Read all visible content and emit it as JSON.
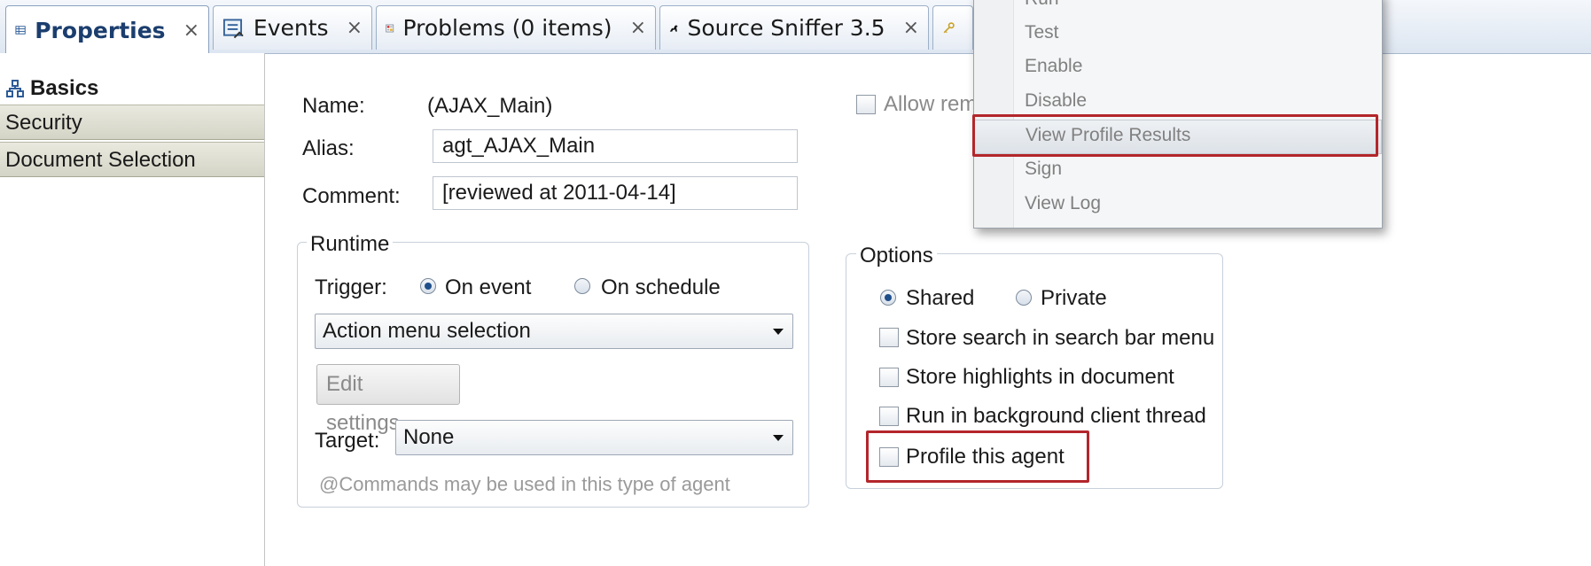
{
  "tabs": [
    {
      "label": "Properties",
      "close": "×"
    },
    {
      "label": "Events",
      "close": "×"
    },
    {
      "label": "Problems (0 items)",
      "close": "×"
    },
    {
      "label": "Source Sniffer 3.5",
      "close": "×"
    }
  ],
  "sections": [
    "Basics",
    "Security",
    "Document Selection"
  ],
  "form": {
    "name_label": "Name:",
    "name_value": "(AJAX_Main)",
    "alias_label": "Alias:",
    "alias_value": "agt_AJAX_Main",
    "comment_label": "Comment:",
    "comment_value": "[reviewed at 2011-04-14]",
    "allow_remote": "Allow rem"
  },
  "runtime": {
    "title": "Runtime",
    "trigger_label": "Trigger:",
    "on_event": "On event",
    "on_schedule": "On schedule",
    "trigger_select": "Action menu selection",
    "edit_settings": "Edit settings...",
    "target_label": "Target:",
    "target_select": "None",
    "hint": "@Commands may be used in this type of agent"
  },
  "options": {
    "title": "Options",
    "shared": "Shared",
    "private": "Private",
    "store_search": "Store search in search bar menu",
    "store_highlights": "Store highlights in document",
    "run_background": "Run in background client thread",
    "profile_agent": "Profile this agent"
  },
  "context_menu": {
    "items": [
      "Run",
      "Test",
      "Enable",
      "Disable",
      "View Profile Results",
      "Sign",
      "View Log"
    ]
  },
  "colors": {
    "highlight": "#b3262b",
    "accent": "#1b3e6e"
  }
}
